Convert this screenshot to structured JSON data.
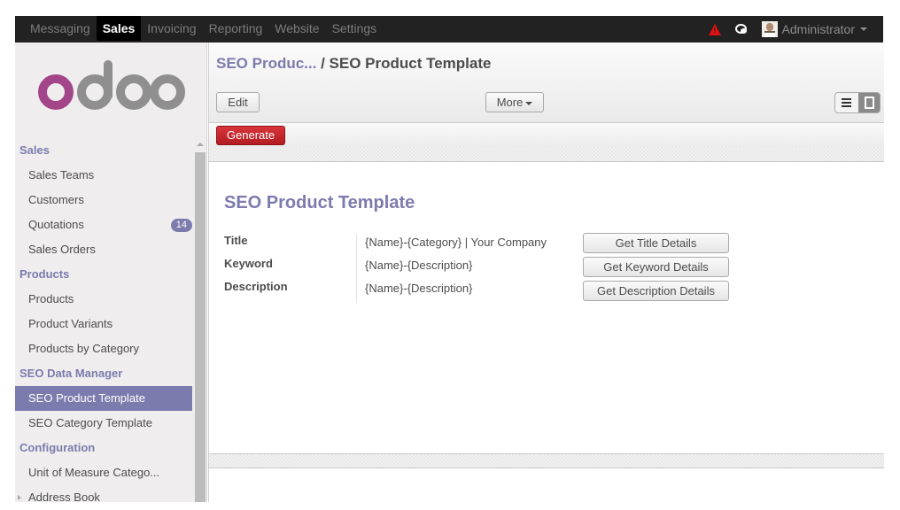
{
  "topbar": {
    "menu": [
      {
        "label": "Messaging",
        "active": false
      },
      {
        "label": "Sales",
        "active": true
      },
      {
        "label": "Invoicing",
        "active": false
      },
      {
        "label": "Reporting",
        "active": false
      },
      {
        "label": "Website",
        "active": false
      },
      {
        "label": "Settings",
        "active": false
      }
    ],
    "alert_glyph": "!",
    "user": "Administrator"
  },
  "sidebar": {
    "logo": "odoo",
    "sections": [
      {
        "header": "Sales",
        "items": [
          {
            "label": "Sales Teams"
          },
          {
            "label": "Customers"
          },
          {
            "label": "Quotations",
            "badge": "14"
          },
          {
            "label": "Sales Orders"
          }
        ]
      },
      {
        "header": "Products",
        "items": [
          {
            "label": "Products"
          },
          {
            "label": "Product Variants"
          },
          {
            "label": "Products by Category"
          }
        ]
      },
      {
        "header": "SEO Data Manager",
        "items": [
          {
            "label": "SEO Product Template",
            "active": true
          },
          {
            "label": "SEO Category Template"
          }
        ]
      },
      {
        "header": "Configuration",
        "items": [
          {
            "label": "Unit of Measure Catego..."
          },
          {
            "label": "Address Book",
            "expandable": true
          }
        ]
      }
    ]
  },
  "control_panel": {
    "breadcrumb_parent": "SEO Produc...",
    "breadcrumb_sep": " / ",
    "breadcrumb_current": "SEO Product Template",
    "edit_label": "Edit",
    "more_label": "More"
  },
  "statusbar": {
    "generate_label": "Generate"
  },
  "form": {
    "title": "SEO Product Template",
    "fields": [
      {
        "label": "Title",
        "value": "{Name}-{Category} | Your Company",
        "button": "Get Title Details"
      },
      {
        "label": "Keyword",
        "value": "{Name}-{Description}",
        "button": "Get Keyword Details"
      },
      {
        "label": "Description",
        "value": "{Name}-{Description}",
        "button": "Get Description Details"
      }
    ]
  },
  "colors": {
    "brand": "#7c7bad",
    "logo_accent": "#a24689",
    "logo_grey": "#8f8f8f",
    "primary_button": "#c42127",
    "topbar": "#222222"
  }
}
